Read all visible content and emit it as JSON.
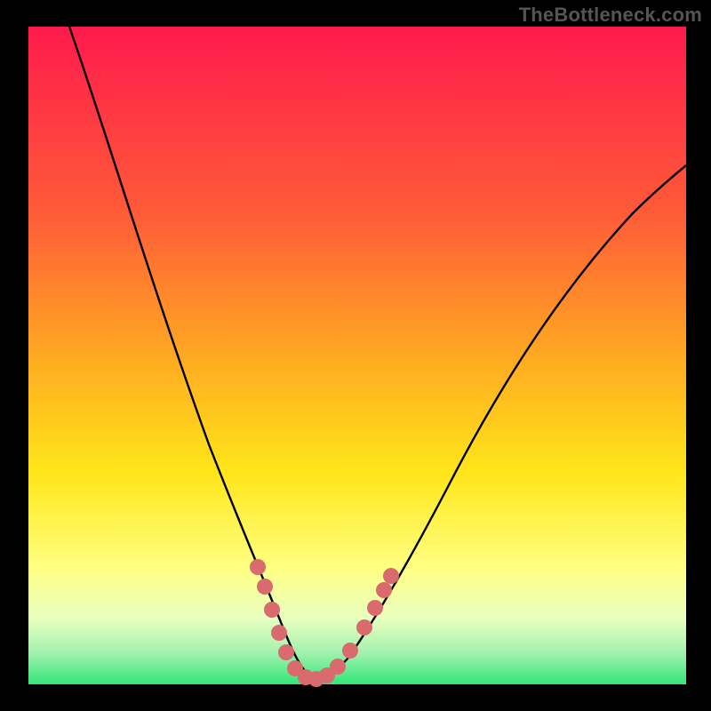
{
  "watermark": "TheBottleneck.com",
  "colors": {
    "frame": "#000000",
    "grad_top": "#ff1a4d",
    "grad_mid1": "#ff6a2f",
    "grad_mid2": "#ffd21f",
    "grad_mid3": "#ffff66",
    "grad_mid4": "#e6ffb3",
    "grad_bottom": "#33e67a",
    "curve": "#000000",
    "marker": "#d96a6e"
  },
  "chart_data": {
    "type": "line",
    "title": "",
    "xlabel": "",
    "ylabel": "",
    "xlim": [
      0,
      100
    ],
    "ylim": [
      0,
      100
    ],
    "series": [
      {
        "name": "bottleneck-curve",
        "x": [
          6,
          10,
          14,
          18,
          22,
          26,
          30,
          32,
          34,
          36,
          38,
          40,
          42,
          44,
          48,
          54,
          60,
          68,
          76,
          86,
          96,
          100
        ],
        "y": [
          100,
          86,
          73,
          60,
          48,
          36,
          24,
          18,
          12,
          6,
          2,
          0,
          0,
          2,
          6,
          14,
          24,
          36,
          48,
          60,
          70,
          74
        ]
      }
    ],
    "markers": {
      "name": "highlight-dots",
      "points": [
        {
          "x": 32,
          "y": 17
        },
        {
          "x": 33,
          "y": 13
        },
        {
          "x": 34.5,
          "y": 8
        },
        {
          "x": 36,
          "y": 4
        },
        {
          "x": 38,
          "y": 1
        },
        {
          "x": 40,
          "y": 0
        },
        {
          "x": 42,
          "y": 0
        },
        {
          "x": 44,
          "y": 1.5
        },
        {
          "x": 46,
          "y": 4
        },
        {
          "x": 48,
          "y": 8
        },
        {
          "x": 50,
          "y": 12
        },
        {
          "x": 51,
          "y": 15
        }
      ]
    },
    "minimum_at_x": 41
  }
}
